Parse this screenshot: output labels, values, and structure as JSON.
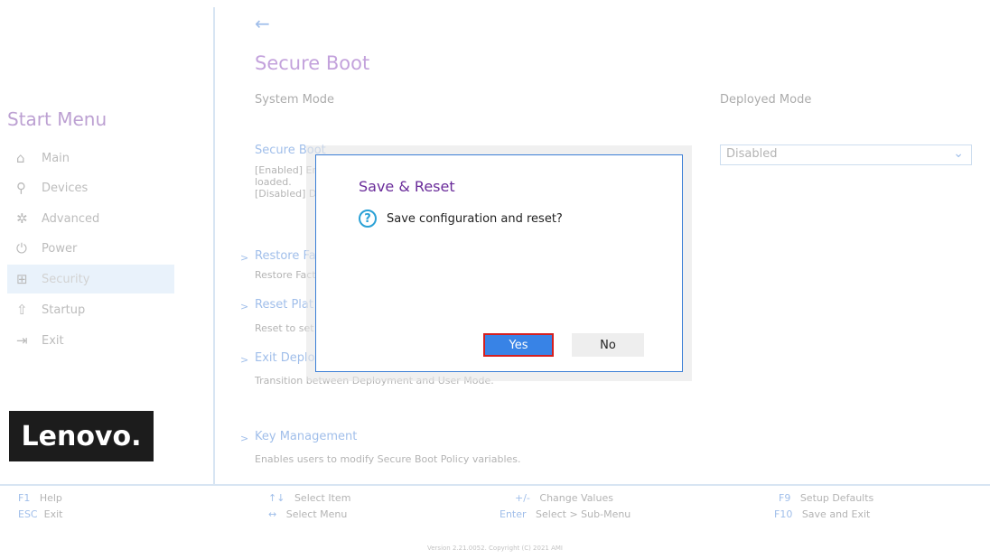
{
  "sidebar": {
    "title": "Start Menu",
    "items": [
      {
        "label": "Main",
        "icon": "⌂"
      },
      {
        "label": "Devices",
        "icon": "⚲"
      },
      {
        "label": "Advanced",
        "icon": "✲"
      },
      {
        "label": "Power",
        "icon": "⏻"
      },
      {
        "label": "Security",
        "icon": "⊞"
      },
      {
        "label": "Startup",
        "icon": "⇧"
      },
      {
        "label": "Exit",
        "icon": "⇥"
      }
    ],
    "active": "Security",
    "logo": "Lenovo."
  },
  "main": {
    "back": "←",
    "title": "Secure Boot",
    "system_mode_label": "System Mode",
    "deployed_mode_label": "Deployed Mode",
    "secure_boot": {
      "title": "Secure Boot",
      "desc_line1": "[Enabled] Er",
      "desc_line2": "loaded.",
      "desc_line3": "[Disabled] D",
      "value": "Disabled"
    },
    "restore": {
      "title": "Restore Fa",
      "desc": "Restore Fact"
    },
    "reset_platform": {
      "title": "Reset Plat",
      "desc": "Reset to set"
    },
    "exit_deploy": {
      "title": "Exit Deplo",
      "desc": "Transition between Deployment and User Mode."
    },
    "key_mgmt": {
      "title": "Key Management",
      "desc": "Enables users to modify Secure Boot Policy variables."
    }
  },
  "footer": {
    "f1_key": "F1",
    "f1_label": "Help",
    "esc_key": "ESC",
    "esc_label": "Exit",
    "item_key": "↑↓",
    "item_label": "Select Item",
    "menu_key": "↔",
    "menu_label": "Select Menu",
    "change_key": "+/-",
    "change_label": "Change Values",
    "enter_key": "Enter",
    "enter_label": "Select > Sub-Menu",
    "f9_key": "F9",
    "f9_label": "Setup Defaults",
    "f10_key": "F10",
    "f10_label": "Save and Exit",
    "version": "Version 2.21.0052. Copyright (C) 2021 AMI"
  },
  "dialog": {
    "title": "Save & Reset",
    "message": "Save configuration and reset?",
    "yes": "Yes",
    "no": "No"
  },
  "colors": {
    "accent": "#2b6fd0",
    "title": "#7a2fb0",
    "yes_button": "#3883e6",
    "highlight_border": "#d42020"
  }
}
